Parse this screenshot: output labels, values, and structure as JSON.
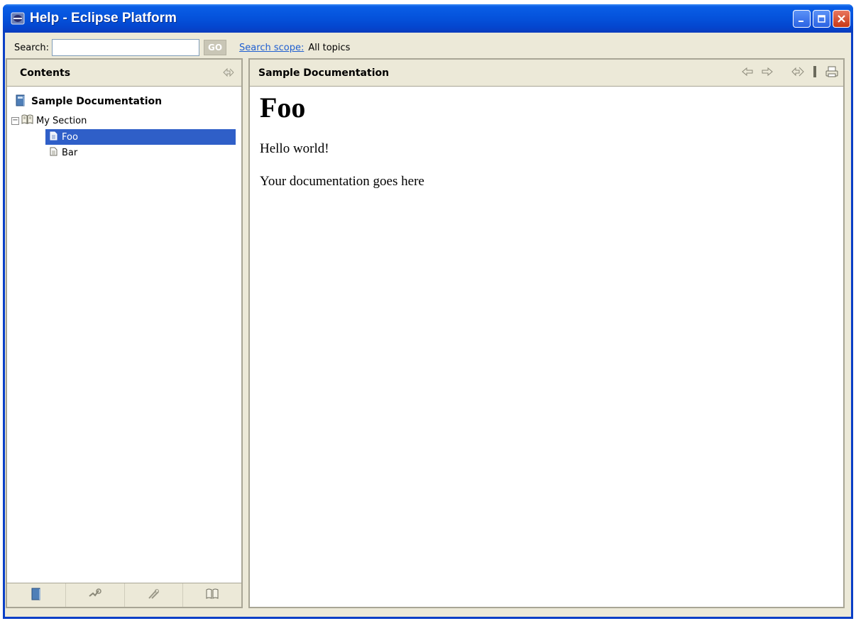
{
  "window": {
    "title": "Help - Eclipse Platform",
    "titlebar_color": "#0553dc"
  },
  "search": {
    "label": "Search:",
    "value": "",
    "go_label": "GO",
    "scope_link": "Search scope:",
    "scope_value": "All topics"
  },
  "contents": {
    "header": "Contents",
    "book": "Sample Documentation",
    "section": "My Section",
    "topics": [
      "Foo",
      "Bar"
    ],
    "selected_topic": "Foo",
    "footer_tabs": [
      "contents-icon",
      "search-icon",
      "bookmarks-icon",
      "index-icon"
    ]
  },
  "document": {
    "header": "Sample Documentation",
    "heading": "Foo",
    "paragraphs": [
      "Hello world!",
      "Your documentation goes here"
    ]
  },
  "colors": {
    "selection": "#2f5fc8",
    "link": "#1f5fd1",
    "chrome": "#ece9d8"
  }
}
